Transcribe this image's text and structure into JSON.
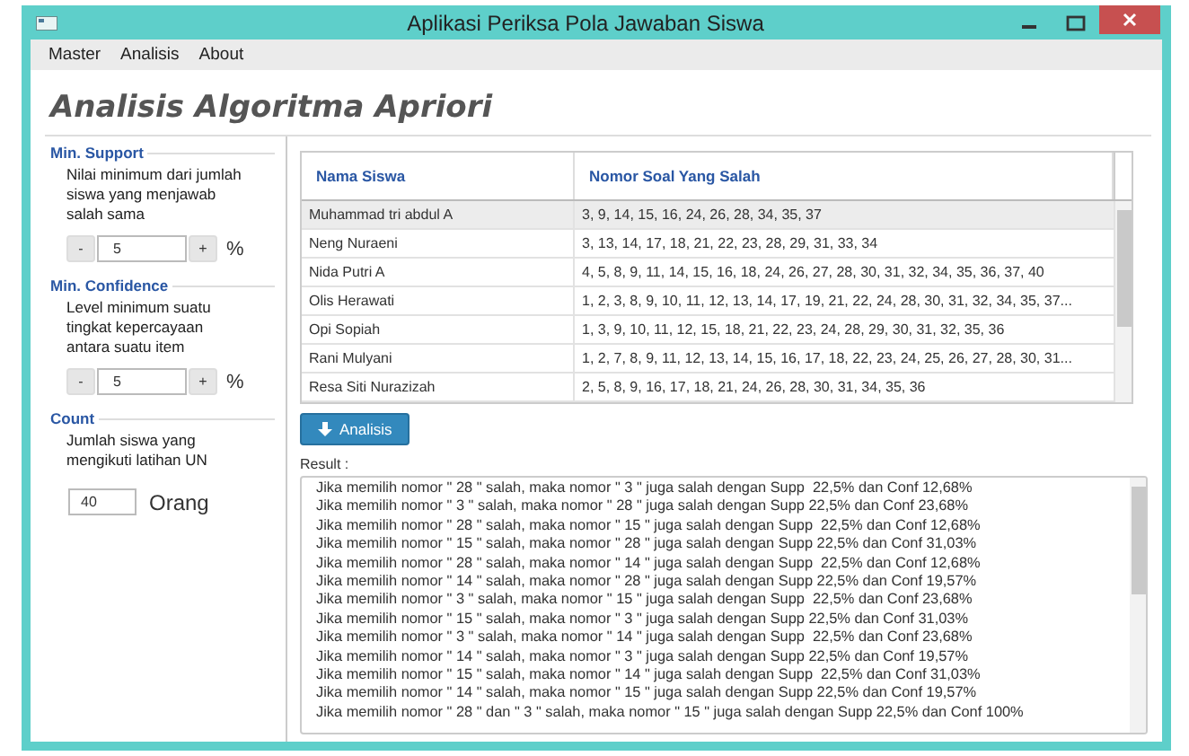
{
  "window": {
    "title": "Aplikasi Periksa Pola Jawaban Siswa"
  },
  "menu": [
    "Master",
    "Analisis",
    "About"
  ],
  "heading": "Analisis Algoritma Apriori",
  "settings": [
    {
      "kind": "spinner",
      "title": "Min. Support",
      "description": "Nilai minimum dari jumlah siswa yang menjawab salah sama",
      "decrement": "-",
      "value": "5",
      "increment": "+",
      "unit": "%"
    },
    {
      "kind": "spinner",
      "title": "Min. Confidence",
      "description": "Level minimum suatu tingkat kepercayaan antara suatu item",
      "decrement": "-",
      "value": "5",
      "increment": "+",
      "unit": "%"
    },
    {
      "kind": "field",
      "title": "Count",
      "description": "Jumlah siswa yang mengikuti latihan UN",
      "value": "40",
      "unit": "Orang"
    }
  ],
  "table": {
    "columns": [
      "Nama Siswa",
      "Nomor Soal Yang Salah"
    ],
    "rows": [
      {
        "name": "Muhammad tri abdul A",
        "answers": "3, 9, 14, 15, 16, 24, 26, 28, 34, 35, 37",
        "selected": true
      },
      {
        "name": "Neng Nuraeni",
        "answers": "3, 13, 14, 17, 18, 21, 22, 23, 28, 29, 31, 33, 34",
        "selected": false
      },
      {
        "name": "Nida Putri A",
        "answers": "4, 5, 8, 9, 11, 14, 15, 16, 18, 24, 26, 27, 28, 30, 31, 32, 34, 35, 36, 37, 40",
        "selected": false
      },
      {
        "name": "Olis Herawati",
        "answers": "1, 2, 3, 8, 9, 10, 11, 12, 13, 14, 17, 19, 21, 22, 24, 28, 30, 31, 32, 34, 35, 37...",
        "selected": false
      },
      {
        "name": "Opi Sopiah",
        "answers": "1, 3, 9, 10, 11, 12, 15, 18, 21, 22, 23, 24, 28, 29, 30, 31, 32, 35, 36",
        "selected": false
      },
      {
        "name": "Rani Mulyani",
        "answers": "1, 2, 7, 8, 9, 11, 12, 13, 14, 15, 16, 17, 18, 22, 23, 24, 25, 26, 27, 28, 30, 31...",
        "selected": false
      },
      {
        "name": "Resa Siti Nurazizah",
        "answers": "2, 5, 8, 9, 16, 17, 18, 21, 24, 26, 28, 30, 31, 34, 35, 36",
        "selected": false
      }
    ]
  },
  "analyze_button": "Analisis",
  "result": {
    "label": "Result :",
    "lines": [
      "Jika memilih nomor \" 28 \" salah, maka nomor \" 3 \" juga salah dengan Supp  22,5% dan Conf 12,68%",
      "Jika memilih nomor \" 3 \" salah, maka nomor \" 28 \" juga salah dengan Supp 22,5% dan Conf 23,68%",
      "Jika memilih nomor \" 28 \" salah, maka nomor \" 15 \" juga salah dengan Supp  22,5% dan Conf 12,68%",
      "Jika memilih nomor \" 15 \" salah, maka nomor \" 28 \" juga salah dengan Supp 22,5% dan Conf 31,03%",
      "Jika memilih nomor \" 28 \" salah, maka nomor \" 14 \" juga salah dengan Supp  22,5% dan Conf 12,68%",
      "Jika memilih nomor \" 14 \" salah, maka nomor \" 28 \" juga salah dengan Supp 22,5% dan Conf 19,57%",
      "Jika memilih nomor \" 3 \" salah, maka nomor \" 15 \" juga salah dengan Supp  22,5% dan Conf 23,68%",
      "Jika memilih nomor \" 15 \" salah, maka nomor \" 3 \" juga salah dengan Supp 22,5% dan Conf 31,03%",
      "Jika memilih nomor \" 3 \" salah, maka nomor \" 14 \" juga salah dengan Supp  22,5% dan Conf 23,68%",
      "Jika memilih nomor \" 14 \" salah, maka nomor \" 3 \" juga salah dengan Supp 22,5% dan Conf 19,57%",
      "Jika memilih nomor \" 15 \" salah, maka nomor \" 14 \" juga salah dengan Supp  22,5% dan Conf 31,03%",
      "Jika memilih nomor \" 14 \" salah, maka nomor \" 15 \" juga salah dengan Supp 22,5% dan Conf 19,57%",
      "Jika memilih nomor \" 28 \" dan \" 3 \" salah, maka nomor \" 15 \" juga salah dengan Supp 22,5% dan Conf 100%"
    ]
  }
}
